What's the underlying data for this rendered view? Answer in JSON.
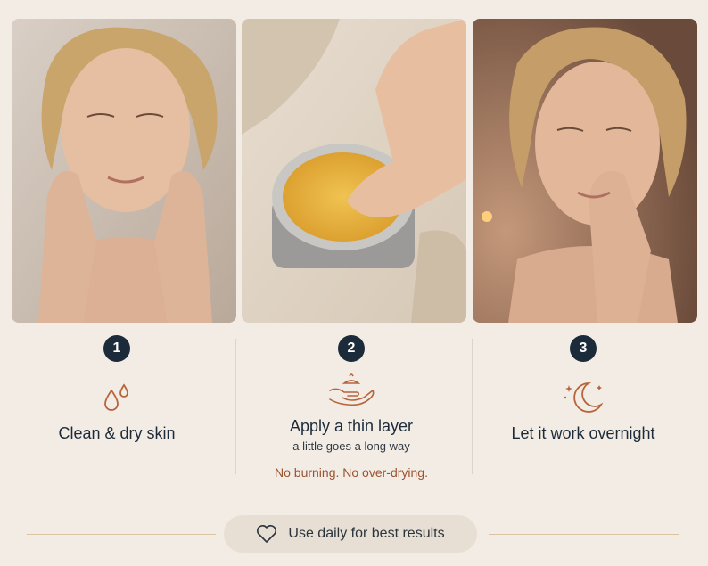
{
  "photos": [
    {
      "alt": "Woman cleansing face with both hands"
    },
    {
      "alt": "Finger dipping into an open tin of golden balm"
    },
    {
      "alt": "Woman smoothing balm onto cheek in candlelight"
    }
  ],
  "steps": [
    {
      "number": "1",
      "icon": "water-drops-icon",
      "title": "Clean & dry skin"
    },
    {
      "number": "2",
      "icon": "hand-with-balm-icon",
      "title": "Apply a thin layer",
      "subtitle": "a little goes a long way",
      "note": "No burning. No over-drying."
    },
    {
      "number": "3",
      "icon": "moon-and-stars-icon",
      "title": "Let it work overnight"
    }
  ],
  "footer": {
    "icon": "heart-icon",
    "text": "Use daily for best results"
  },
  "colors": {
    "background": "#f3ece4",
    "accent": "#b5643c",
    "badge": "#1c2b3a",
    "note": "#9a5330"
  }
}
